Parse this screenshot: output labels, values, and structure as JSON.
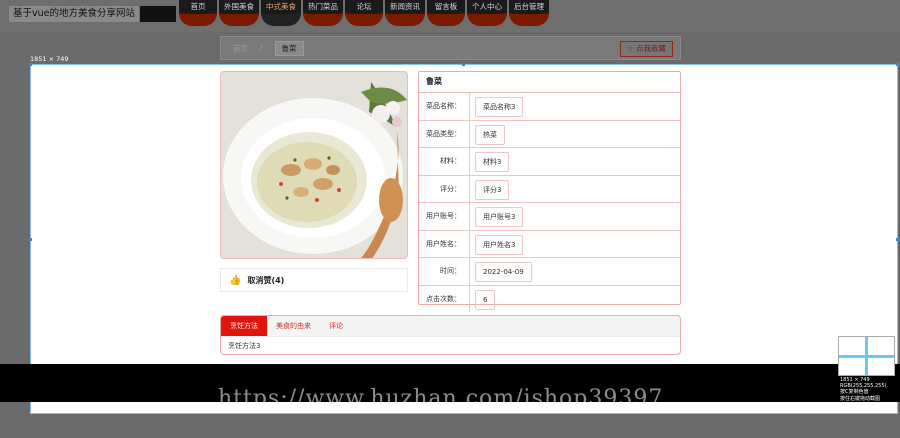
{
  "site": {
    "title": "基于vue的地方美食分享网站"
  },
  "nav": {
    "items": [
      "首页",
      "外国美食",
      "中式美食",
      "热门菜品",
      "论坛",
      "新闻资讯",
      "留言板",
      "个人中心",
      "后台管理"
    ],
    "active_index": 2
  },
  "breadcrumb": {
    "home": "首页",
    "separator": "/",
    "current": "鲁菜"
  },
  "favorite_button": {
    "label": "☆ 点我收藏"
  },
  "screenshot_size": "1851 × 749",
  "dish": {
    "header": "鲁菜",
    "fields": [
      {
        "label": "菜品名称：",
        "value": "菜品名称3"
      },
      {
        "label": "菜品类型：",
        "value": "热菜"
      },
      {
        "label": "材料：",
        "value": "材料3"
      },
      {
        "label": "评分：",
        "value": "评分3"
      },
      {
        "label": "用户账号：",
        "value": "用户账号3"
      },
      {
        "label": "用户姓名：",
        "value": "用户姓名3"
      },
      {
        "label": "时间：",
        "value": "2022-04-09"
      },
      {
        "label": "点击次数：",
        "value": "6"
      }
    ],
    "unlike_label": "取消赞(4)"
  },
  "tabs": {
    "items": [
      "烹饪方法",
      "美食的由来",
      "评论"
    ],
    "active_index": 0,
    "content": "烹饪方法3"
  },
  "watermark": "https://www.huzhan.com/ishop39397",
  "picker": {
    "line1": "1851 × 749",
    "line2": "RGB(255,255,255)",
    "line3": "按C复制色值",
    "line4": "按住右键拖动截图"
  },
  "colors": {
    "accent": "#e0150b",
    "border_pink": "#f1a9a9",
    "selection": "#7ec3f2"
  }
}
